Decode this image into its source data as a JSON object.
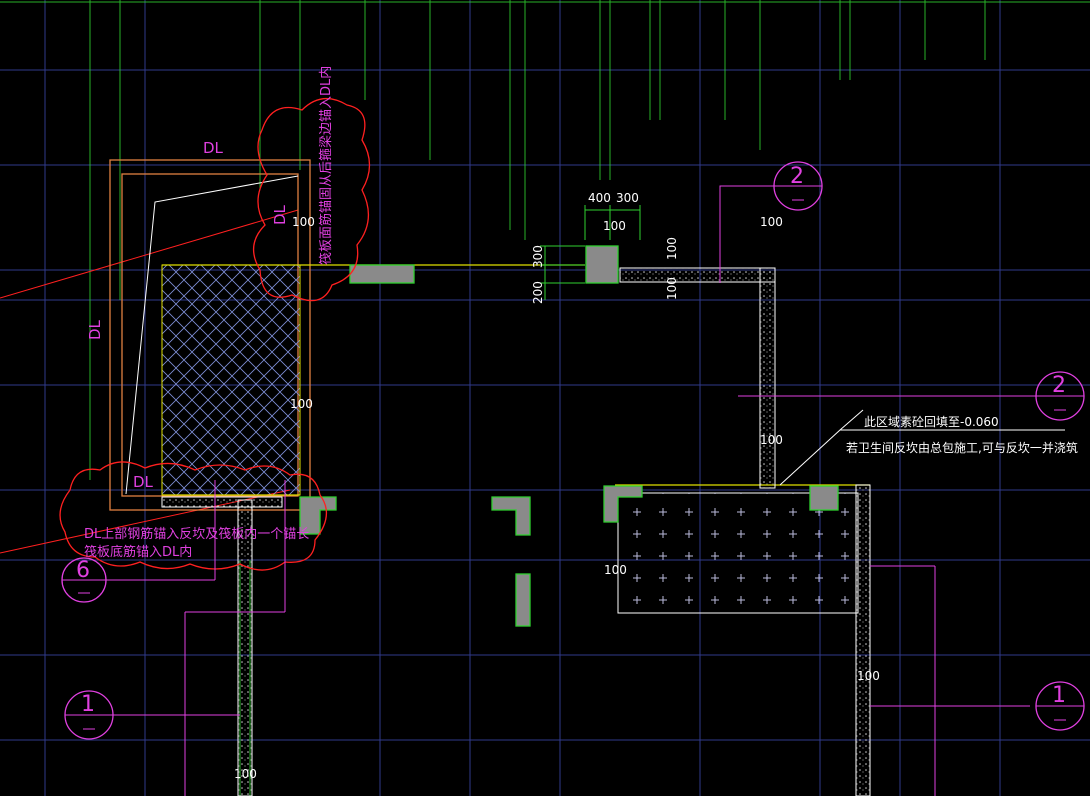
{
  "colors": {
    "background": "#000000",
    "grid_green": "#2fd02f",
    "grid_blue": "#303a8a",
    "slab_outline": "#e0e000",
    "magenta": "#e040e0",
    "orange": "#e08040",
    "red": "#ff2020",
    "column_fill": "#8a8a8a"
  },
  "labels": {
    "dl_top": "DL",
    "dl_left": "DL",
    "dl_bottom": "DL",
    "dl_slanted": "DL"
  },
  "dimensions": {
    "d400": "400",
    "d300": "300",
    "d100_top": "100",
    "d300_vert": "300",
    "d200_vert": "200",
    "d100_a": "100",
    "d100_b": "100",
    "d100_c": "100",
    "d100_d": "100",
    "d100_e": "100",
    "d100_f": "100",
    "d100_g": "100",
    "d100_h": "100",
    "d100_i": "100"
  },
  "notes": {
    "cloud_top": "筏板面筋锚固从后箍梁边锚入DL内",
    "cloud_bottom_line1": "DL上部钢筋锚入反坎及筏板内一个锚长",
    "cloud_bottom_line2": "筏板底筋锚入DL内",
    "fill_note": "此区域素砼回填至-0.060",
    "kerb_note": "若卫生间反坎由总包施工,可与反坎一并浇筑"
  },
  "axis_markers": {
    "marker_2_top": "2",
    "marker_2_right": "2",
    "marker_1_right": "1",
    "marker_1_left": "1",
    "marker_6_left": "6"
  }
}
